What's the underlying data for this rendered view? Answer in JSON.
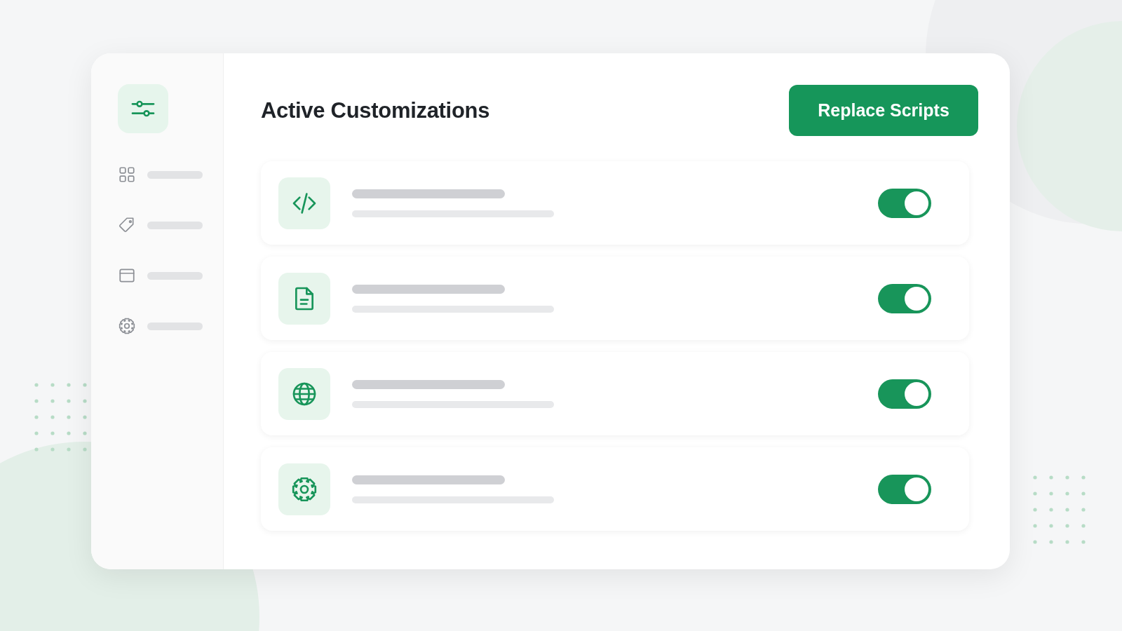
{
  "sidebar": {
    "items": [
      {
        "kind": "grid",
        "selected": false
      },
      {
        "kind": "tag",
        "selected": false
      },
      {
        "kind": "window",
        "selected": false
      },
      {
        "kind": "gear",
        "selected": false
      }
    ]
  },
  "header": {
    "title": "Active Customizations",
    "button": "Replace Scripts"
  },
  "customizations": [
    {
      "kind": "code",
      "on": true
    },
    {
      "kind": "file",
      "on": true
    },
    {
      "kind": "globe",
      "on": true
    },
    {
      "kind": "gear",
      "on": true
    }
  ]
}
